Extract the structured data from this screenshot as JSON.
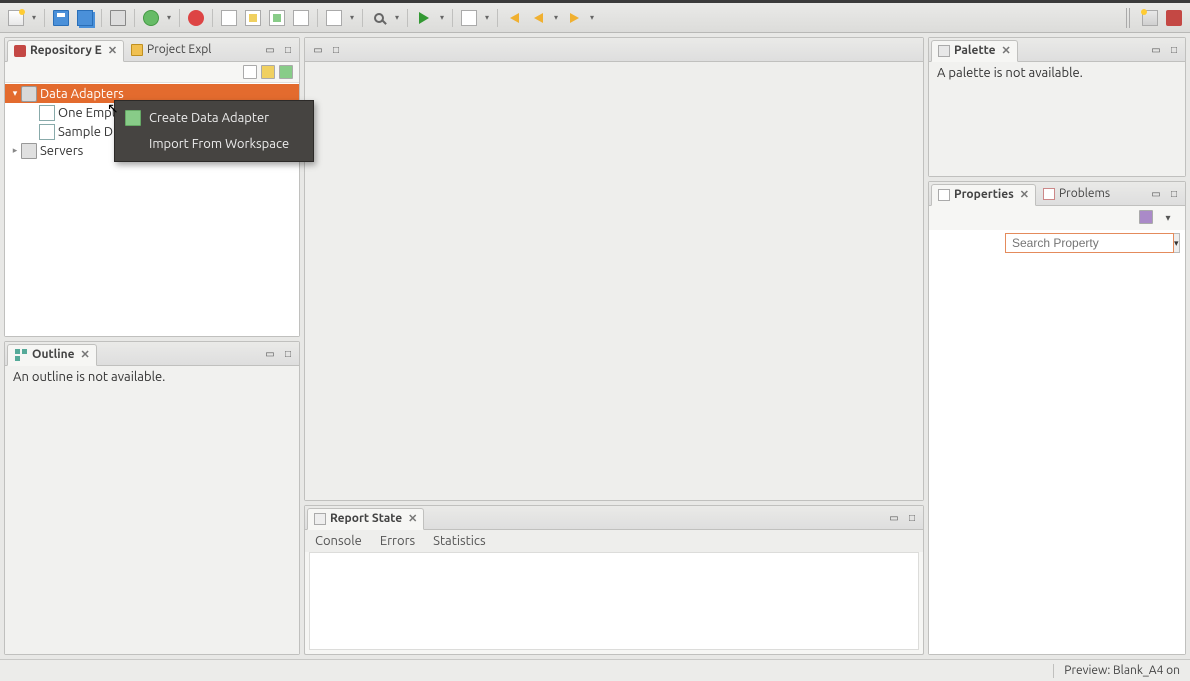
{
  "views": {
    "repository": {
      "tab": "Repository E",
      "other_tab": "Project Expl"
    },
    "outline": {
      "tab": "Outline",
      "empty": "An outline is not available."
    },
    "palette": {
      "tab": "Palette",
      "empty": "A palette is not available."
    },
    "properties": {
      "tab": "Properties",
      "other_tab": "Problems",
      "search_placeholder": "Search Property"
    },
    "report": {
      "tab": "Report State",
      "subtabs": [
        "Console",
        "Errors",
        "Statistics"
      ]
    }
  },
  "tree": {
    "items": [
      {
        "label": "Data Adapters",
        "selected": true,
        "depth": 0,
        "icon": "db",
        "expanded": true
      },
      {
        "label": "One Empty",
        "selected": false,
        "depth": 1,
        "icon": "sheet"
      },
      {
        "label": "Sample DB",
        "selected": false,
        "depth": 1,
        "icon": "sheet"
      },
      {
        "label": "Servers",
        "selected": false,
        "depth": 0,
        "icon": "server"
      }
    ]
  },
  "context_menu": {
    "items": [
      {
        "label": "Create Data Adapter",
        "icon": true
      },
      {
        "label": "Import From Workspace",
        "icon": false
      }
    ]
  },
  "status": {
    "text": "Preview: Blank_A4 on"
  }
}
